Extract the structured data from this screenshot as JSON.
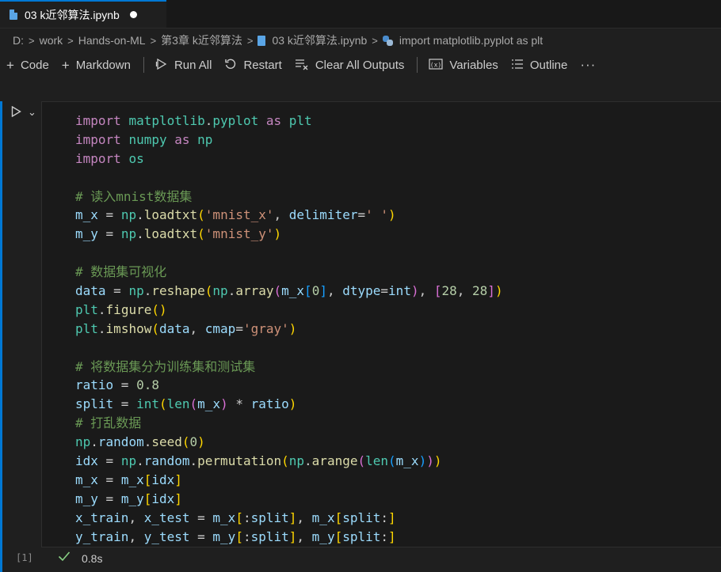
{
  "tab": {
    "title": "03 k近邻算法.ipynb"
  },
  "breadcrumb": [
    "D:",
    "work",
    "Hands-on-ML",
    "第3章 k近邻算法",
    "03 k近邻算法.ipynb",
    "import matplotlib.pyplot as plt"
  ],
  "toolbar": {
    "code": "Code",
    "markdown": "Markdown",
    "run_all": "Run All",
    "restart": "Restart",
    "clear_outputs": "Clear All Outputs",
    "variables": "Variables",
    "outline": "Outline",
    "more": "···"
  },
  "cell": {
    "execution_count": "[1]",
    "exec_time": "0.8s",
    "status": "success",
    "code_lines": [
      "import matplotlib.pyplot as plt",
      "import numpy as np",
      "import os",
      "",
      "# 读入mnist数据集",
      "m_x = np.loadtxt('mnist_x', delimiter=' ')",
      "m_y = np.loadtxt('mnist_y')",
      "",
      "# 数据集可视化",
      "data = np.reshape(np.array(m_x[0], dtype=int), [28, 28])",
      "plt.figure()",
      "plt.imshow(data, cmap='gray')",
      "",
      "# 将数据集分为训练集和测试集",
      "ratio = 0.8",
      "split = int(len(m_x) * ratio)",
      "# 打乱数据",
      "np.random.seed(0)",
      "idx = np.random.permutation(np.arange(len(m_x)))",
      "m_x = m_x[idx]",
      "m_y = m_y[idx]",
      "x_train, x_test = m_x[:split], m_x[split:]",
      "y_train, y_test = m_y[:split], m_y[split:]"
    ]
  },
  "colors": {
    "accent": "#0078d4",
    "keyword": "#c586c0",
    "module": "#4ec9b0",
    "variable": "#9cdcfe",
    "function": "#dcdcaa",
    "string": "#ce9178",
    "number": "#b5cea8",
    "comment": "#6a9955",
    "success": "#89d185"
  }
}
